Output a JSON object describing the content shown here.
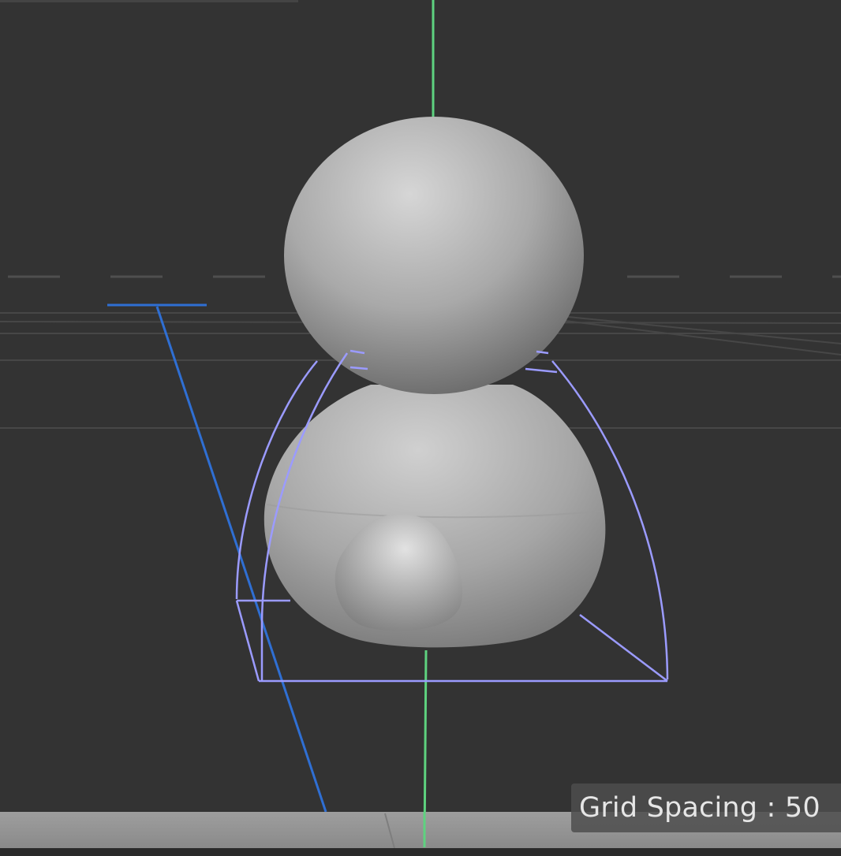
{
  "viewport": {
    "background_color": "#333333",
    "grid_spacing_label": "Grid Spacing : 50"
  },
  "colors": {
    "y_axis": "#5ed27f",
    "selection_outline": "#9b9bff",
    "light_gizmo": "#2f6fd3",
    "grid_line": "#4a4a4a",
    "model_shading": "#bdbdbd"
  },
  "icons": {
    "light_gizmo": "spotlight-icon",
    "selection": "selection-outline-icon"
  }
}
